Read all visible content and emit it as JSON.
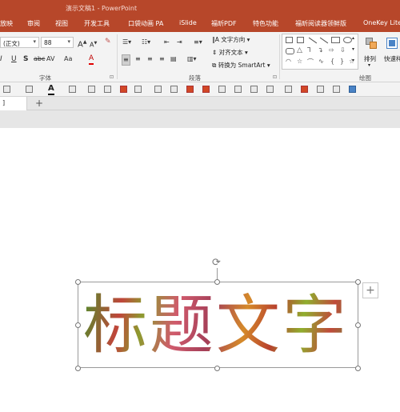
{
  "window": {
    "title": "演示文稿1 - PowerPoint",
    "accent": "#b7472a"
  },
  "tabs": [
    "放映",
    "审阅",
    "视图",
    "开发工具",
    "口袋动画 PA",
    "iSlide",
    "福昕PDF",
    "特色功能",
    "福昕阅读器领鲜版",
    "OneKey Lite"
  ],
  "ribbon": {
    "font": {
      "name": "(正文)",
      "size": "88",
      "group_label": "字体",
      "grow": "A",
      "shrink": "A",
      "clear": "✎",
      "italic": "I",
      "underline": "U",
      "shadow": "S",
      "strike": "abc",
      "spacing": "AV",
      "case": "Aa",
      "color": "A"
    },
    "paragraph": {
      "group_label": "段落",
      "text_direction": "文字方向",
      "align_text": "对齐文本",
      "smartart": "转换为 SmartArt"
    },
    "drawing": {
      "group_label": "绘图",
      "arrange": "排列",
      "quick_styles": "快速样"
    }
  },
  "document_tab": {
    "label": "]",
    "add": "+"
  },
  "slide": {
    "text": "标题文字"
  },
  "icons": [
    "rotate-handle-icon",
    "layout-options-icon",
    "chevron-down-icon"
  ]
}
